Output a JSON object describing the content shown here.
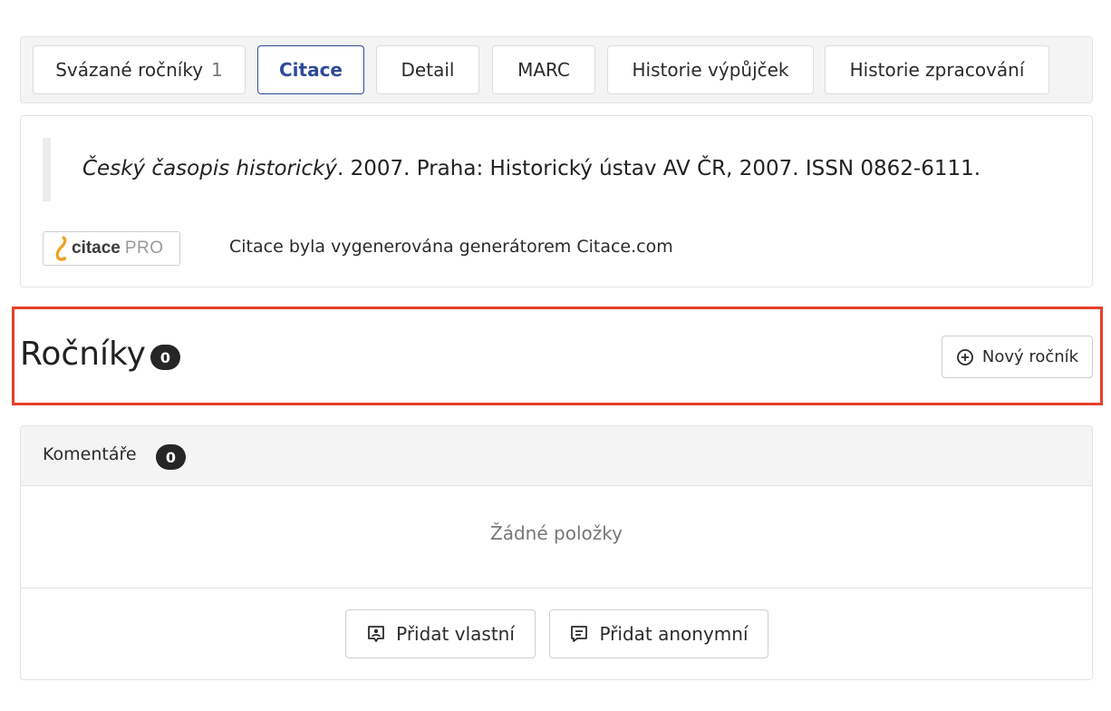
{
  "tabs": [
    {
      "label": "Svázané ročníky",
      "count": "1"
    },
    {
      "label": "Citace"
    },
    {
      "label": "Detail"
    },
    {
      "label": "MARC"
    },
    {
      "label": "Historie výpůjček"
    },
    {
      "label": "Historie zpracování"
    }
  ],
  "citation": {
    "title": "Český časopis historický",
    "rest": ". 2007. Praha: Historický ústav AV ČR, 2007. ISSN 0862-6111.",
    "logo_word": "citace",
    "logo_pro": "PRO",
    "generator_note": "Citace byla vygenerována generátorem Citace.com"
  },
  "volumes": {
    "title": "Ročníky",
    "count": "0",
    "new_button": "Nový ročník"
  },
  "comments": {
    "title": "Komentáře",
    "count": "0",
    "empty_text": "Žádné položky",
    "add_own": "Přidat vlastní",
    "add_anonymous": "Přidat anonymní"
  },
  "icons": {
    "new_volume": "plus-circle-icon",
    "add_own": "user-comment-icon",
    "add_anonymous": "comment-lines-icon",
    "logo": "citace-logo-icon"
  },
  "colors": {
    "active_tab": "#2e4a99",
    "highlight": "#e8402a",
    "badge": "#262626",
    "logo_accent": "#f0a020"
  }
}
